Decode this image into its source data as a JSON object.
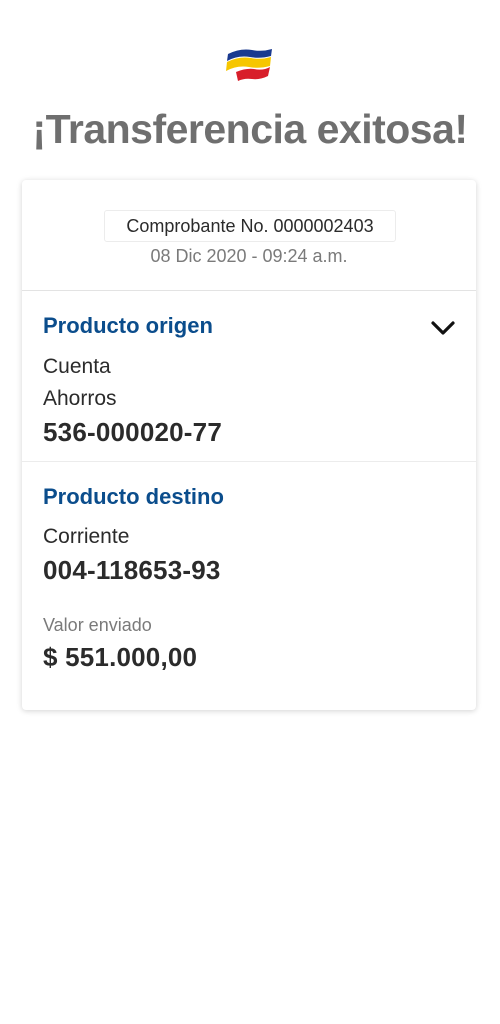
{
  "header": {
    "title": "¡Transferencia exitosa!",
    "logo_icon": "bank-logo-flag-icon",
    "logo_colors": [
      "#1a3a8f",
      "#f6c600",
      "#d81e2a"
    ]
  },
  "receipt": {
    "number_label": "Comprobante No. 0000002403",
    "datetime": "08 Dic 2020 - 09:24 a.m."
  },
  "origin": {
    "title": "Producto origen",
    "type_line1": "Cuenta",
    "type_line2": "Ahorros",
    "account_number": "536-000020-77",
    "toggle_icon": "chevron-down-icon"
  },
  "destination": {
    "title": "Producto destino",
    "type": "Corriente",
    "account_number": "004-118653-93",
    "amount_label": "Valor enviado",
    "amount": "$ 551.000,00"
  },
  "colors": {
    "accent": "#0b4d8c",
    "title_gray": "#6f6f6f",
    "text": "#2b2b2b"
  }
}
